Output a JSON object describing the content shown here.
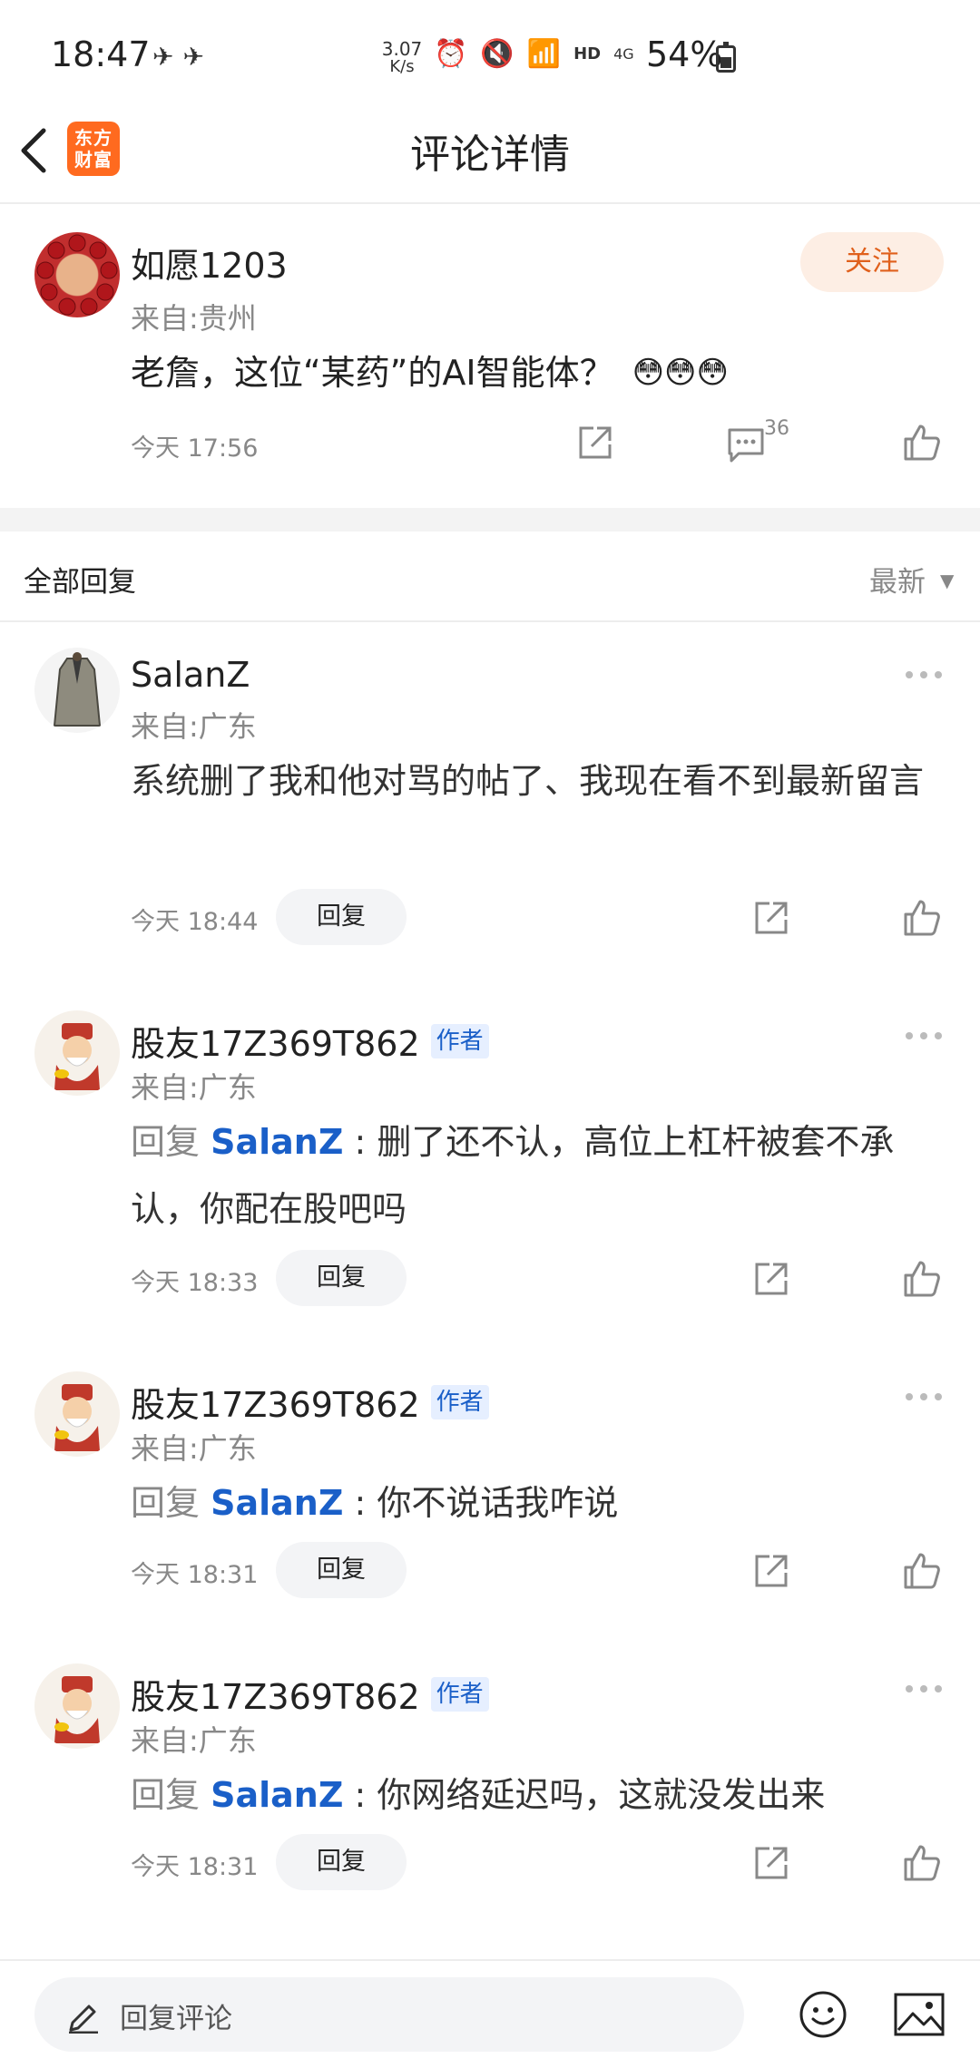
{
  "status_bar": {
    "time": "18:47",
    "speed_value": "3.07",
    "speed_unit": "K/s",
    "hd": "HD",
    "network": "4G",
    "battery": "54%"
  },
  "header": {
    "logo_text": "东方财富",
    "title": "评论详情"
  },
  "main_comment": {
    "username": "如愿1203",
    "location": "来自:贵州",
    "follow_label": "关注",
    "text": "老詹，这位“某药”的AI智能体？",
    "emojis": [
      "😳",
      "😳",
      "😳"
    ],
    "time": "今天 17:56",
    "reply_count": "36"
  },
  "replies_header": {
    "title": "全部回复",
    "sort": "最新"
  },
  "replies": [
    {
      "username": "SalanZ",
      "location": "来自:广东",
      "text": "系统删了我和他对骂的帖了、我现在看不到最新留言",
      "time": "今天 18:44",
      "reply_label": "回复"
    },
    {
      "username": "股友17Z369T862",
      "author_badge": "作者",
      "location": "来自:广东",
      "reply_prefix": "回复",
      "reply_to": "SalanZ",
      "colon": ":",
      "text": "删了还不认，高位上杠杆被套不承认，你配在股吧吗",
      "time": "今天 18:33",
      "reply_label": "回复"
    },
    {
      "username": "股友17Z369T862",
      "author_badge": "作者",
      "location": "来自:广东",
      "reply_prefix": "回复",
      "reply_to": "SalanZ",
      "colon": ":",
      "text": "你不说话我咋说",
      "time": "今天 18:31",
      "reply_label": "回复"
    },
    {
      "username": "股友17Z369T862",
      "author_badge": "作者",
      "location": "来自:广东",
      "reply_prefix": "回复",
      "reply_to": "SalanZ",
      "colon": ":",
      "text": "你网络延迟吗，这就没发出来",
      "time": "今天 18:31",
      "reply_label": "回复"
    }
  ],
  "bottom_bar": {
    "input_placeholder": "回复评论"
  },
  "colors": {
    "accent_blue": "#1a5fc8",
    "follow_bg": "#fdeee4",
    "follow_text": "#e0601c",
    "logo_orange": "#ff6a1f"
  }
}
